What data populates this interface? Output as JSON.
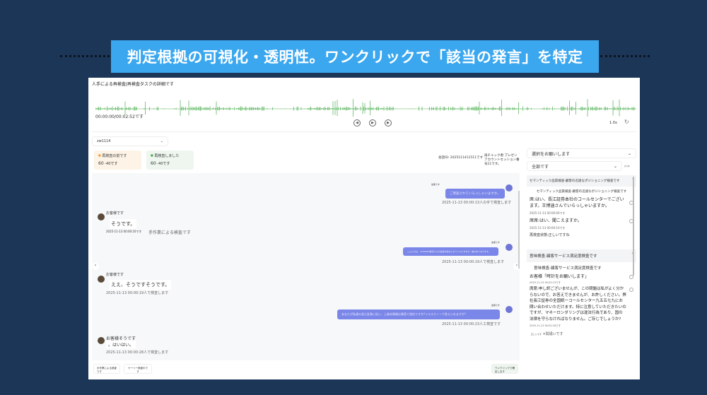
{
  "banner": {
    "text": "判定根拠の可視化・透明性。ワンクリックで「該当の発言」を特定"
  },
  "colors": {
    "background": "#1c3658",
    "banner": "#3aa7ef",
    "wave": "#4caf50",
    "agent_bubble": "#7a86e8"
  },
  "header": {
    "title": "人手による再検査|再検査タスクの詳細です"
  },
  "player": {
    "time": "00:00:00/00:02:52です",
    "speed": "1.0x",
    "buttons": [
      "skip-back",
      "play",
      "skip-forward"
    ]
  },
  "agent_select": {
    "value": "zw1114"
  },
  "stats": [
    {
      "label": "再検査の前です",
      "value": "60",
      "sub": "-40です"
    },
    {
      "label": "再検査しました",
      "value": "60",
      "sub": "-40です"
    }
  ],
  "meta": {
    "session_id": "会話ID: 2025111411511です",
    "checker": "再チェック者:プレゼンアカウントセッション番号11です。"
  },
  "messages": [
    {
      "side": "right",
      "speaker": "坐席です",
      "text": "ご用途されていらっしゃいますか。",
      "ts": "2025-11-13 00:00:13人の手で検査します"
    },
    {
      "side": "left",
      "speaker": "お客様です",
      "text": "そうです。",
      "ts": "2025-11-13 00:00:16です",
      "note": "手作業による検査です"
    },
    {
      "side": "right",
      "speaker": "坐席です",
      "text": "こんにちは、1000000番目からの電話を担当させていただきます、確かめております。",
      "ts": "2025-11-13 00:00:19人で検査します"
    },
    {
      "side": "left",
      "speaker": "お客様です",
      "text": "ええ、そうですそうです。",
      "ts": "2025-11-13 00:00:19人で検査します"
    },
    {
      "side": "right",
      "speaker": "坐席です",
      "text": "あなたが私達の長江証券に従い、上級本情報は質容で発信ですか?イエスカノーで答えられますか?",
      "ts": "2025-11-13 00:00:23人工検査です"
    },
    {
      "side": "left",
      "speaker": "お客様そうです",
      "text": "。はいはい。",
      "ts": "2025-11-13 00:00:28人で検査します"
    }
  ],
  "footer": {
    "buttons": [
      "手作業による検査です",
      "ケーリー検査中です"
    ],
    "submit": "ワンクリックで確定します"
  },
  "side": {
    "select1": "選択をお願いします",
    "select2": "全部です",
    "select2_extra": "ｽﾃｰﾀｽ",
    "sections": [
      {
        "header": "セマンティック品質検査-顧客の迅速なポジショニング検査です",
        "subtitle": "セマンティック品質検査-顧客の迅速なポジショニング検査です",
        "items": [
          {
            "text": "席:はい、長江証券本社のコールセンターでございます。王博涵さんでいらっしゃいますか。",
            "ts": "2025-11-13 00:00:00です"
          },
          {
            "text": "席席:はい、聞こえますか。",
            "ts": "2025-11-13 00:00:10です"
          }
        ],
        "status": "再検査状態:正しいですね"
      },
      {
        "header": "意味検査-顧客サービス満足度検査です",
        "subtitle": "意味検査-顧客サービス満足度検査です",
        "items": [
          {
            "text": "お客様「時計をお願いします」",
            "ts": "2025-11-13 00:02:13です"
          },
          {
            "text": "席席:申し訳ございませんが、この問題は私がよく分からないので、お答えできませんが、お許しください。弊社長江証券の全国統一コールセンター九五五七九にお問い合わせいただけます。特に注意していただきたいのですが、マネーロンダリングは違法行為であり、国の法律を守らなければなりません。ご存じでしょうか?",
            "ts": "2025-11-13 00:02:16です"
          }
        ],
        "status_ok": "正しいです",
        "status_bad": "×間違いです"
      }
    ]
  }
}
